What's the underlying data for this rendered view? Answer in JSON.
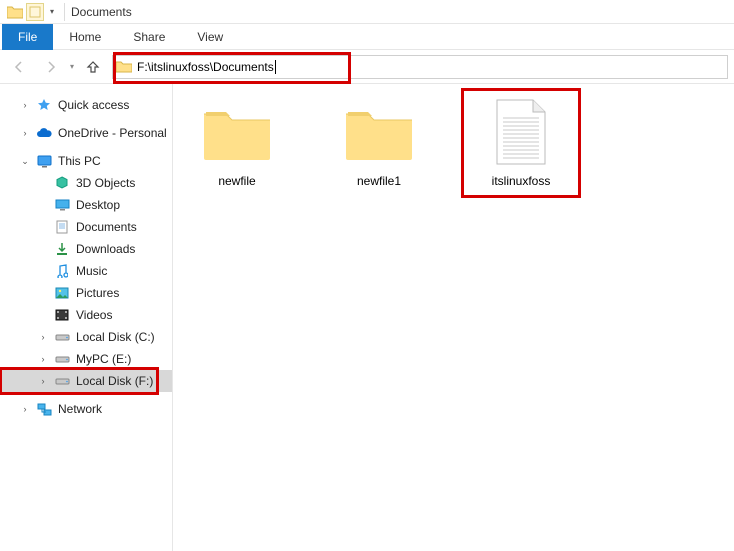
{
  "titlebar": {
    "title": "Documents"
  },
  "ribbon": {
    "file": "File",
    "home": "Home",
    "share": "Share",
    "view": "View"
  },
  "address": {
    "path": "F:\\itslinuxfoss\\Documents"
  },
  "nav": {
    "quick_access": "Quick access",
    "onedrive": "OneDrive - Personal",
    "this_pc": "This PC",
    "children": {
      "objects3d": "3D Objects",
      "desktop": "Desktop",
      "documents": "Documents",
      "downloads": "Downloads",
      "music": "Music",
      "pictures": "Pictures",
      "videos": "Videos",
      "localc": "Local Disk (C:)",
      "mypc_e": "MyPC (E:)",
      "localf": "Local Disk (F:)"
    },
    "network": "Network"
  },
  "content": {
    "items": [
      {
        "type": "folder",
        "label": "newfile"
      },
      {
        "type": "folder",
        "label": "newfile1"
      },
      {
        "type": "textfile",
        "label": "itslinuxfoss",
        "highlight": true
      }
    ]
  }
}
